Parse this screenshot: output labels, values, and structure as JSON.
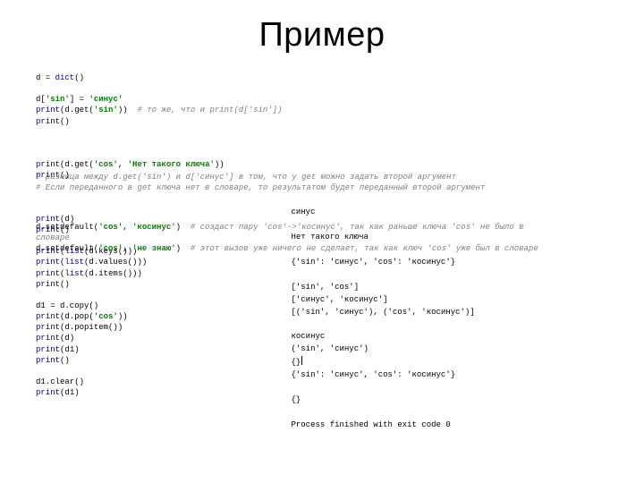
{
  "title": "Пример",
  "code_block1": [
    {
      "segs": [
        {
          "t": "d = "
        },
        {
          "t": "dict",
          "c": "fn"
        },
        {
          "t": "()"
        }
      ]
    },
    {
      "segs": []
    },
    {
      "segs": [
        {
          "t": "d["
        },
        {
          "t": "'sin'",
          "c": "str"
        },
        {
          "t": "] = "
        },
        {
          "t": "'синус'",
          "c": "str"
        }
      ]
    },
    {
      "segs": [
        {
          "t": "print",
          "c": "fn"
        },
        {
          "t": "(d.get("
        },
        {
          "t": "'sin'",
          "c": "str"
        },
        {
          "t": "))  "
        },
        {
          "t": "# то же, что и print(d['sin'])",
          "c": "cm"
        }
      ]
    },
    {
      "segs": [
        {
          "t": "print",
          "c": "fn"
        },
        {
          "t": "()"
        }
      ]
    }
  ],
  "wide_comment": [
    "# разница между d.get('sin') и d['синус'] в том, что у get можно задать второй аргумент",
    "# Если переданного в get ключа нет в словаре, то результатом будет переданный второй аргумент"
  ],
  "code_block2": [
    {
      "segs": [
        {
          "t": "print",
          "c": "fn"
        },
        {
          "t": "(d.get("
        },
        {
          "t": "'cos'",
          "c": "str"
        },
        {
          "t": ", "
        },
        {
          "t": "'Нет такого ключа'",
          "c": "str"
        },
        {
          "t": "))"
        }
      ]
    },
    {
      "segs": [
        {
          "t": "print",
          "c": "fn"
        },
        {
          "t": "()"
        }
      ]
    }
  ],
  "setdefault_lines": [
    {
      "segs": [
        {
          "t": "d.setdefault("
        },
        {
          "t": "'cos'",
          "c": "str"
        },
        {
          "t": ", "
        },
        {
          "t": "'косинус'",
          "c": "str"
        },
        {
          "t": ")  "
        },
        {
          "t": "# создаст пару 'cos'->'косинус', так как раньше ключа 'cos' не было в словаре",
          "c": "cm"
        }
      ]
    },
    {
      "segs": [
        {
          "t": "d.setdefault("
        },
        {
          "t": "'cos'",
          "c": "str"
        },
        {
          "t": ", "
        },
        {
          "t": "'не знаю'",
          "c": "str"
        },
        {
          "t": ")  "
        },
        {
          "t": "# этот вызов уже ничего не сделает, так как ключ 'cos' уже был в словаре",
          "c": "cm"
        }
      ]
    }
  ],
  "code_block3": [
    {
      "segs": [
        {
          "t": "print",
          "c": "fn"
        },
        {
          "t": "(d)"
        }
      ]
    },
    {
      "segs": [
        {
          "t": "print",
          "c": "fn"
        },
        {
          "t": "()"
        }
      ]
    },
    {
      "segs": []
    },
    {
      "segs": [
        {
          "t": "print",
          "c": "fn"
        },
        {
          "t": "("
        },
        {
          "t": "list",
          "c": "fn"
        },
        {
          "t": "(d.keys()))"
        }
      ]
    },
    {
      "segs": [
        {
          "t": "print",
          "c": "fn"
        },
        {
          "t": "("
        },
        {
          "t": "list",
          "c": "fn"
        },
        {
          "t": "(d.values()))"
        }
      ]
    },
    {
      "segs": [
        {
          "t": "print",
          "c": "fn"
        },
        {
          "t": "("
        },
        {
          "t": "list",
          "c": "fn"
        },
        {
          "t": "(d.items()))"
        }
      ]
    },
    {
      "segs": [
        {
          "t": "print",
          "c": "fn"
        },
        {
          "t": "()"
        }
      ]
    },
    {
      "segs": []
    },
    {
      "segs": [
        {
          "t": "d1 = d.copy()"
        }
      ]
    },
    {
      "segs": [
        {
          "t": "print",
          "c": "fn"
        },
        {
          "t": "(d.pop("
        },
        {
          "t": "'cos'",
          "c": "str"
        },
        {
          "t": "))"
        }
      ]
    },
    {
      "segs": [
        {
          "t": "print",
          "c": "fn"
        },
        {
          "t": "(d.popitem())"
        }
      ]
    },
    {
      "segs": [
        {
          "t": "print",
          "c": "fn"
        },
        {
          "t": "(d)"
        }
      ]
    },
    {
      "segs": [
        {
          "t": "print",
          "c": "fn"
        },
        {
          "t": "(d1)"
        }
      ]
    },
    {
      "segs": [
        {
          "t": "print",
          "c": "fn"
        },
        {
          "t": "()"
        }
      ]
    },
    {
      "segs": []
    },
    {
      "segs": [
        {
          "t": "d1.clear()"
        }
      ]
    },
    {
      "segs": [
        {
          "t": "print",
          "c": "fn"
        },
        {
          "t": "(d1)"
        }
      ]
    }
  ],
  "output": [
    "синус",
    "",
    "Нет такого ключа",
    "",
    "{'sin': 'синус', 'cos': 'косинус'}",
    "",
    "['sin', 'cos']",
    "['синус', 'косинус']",
    "[('sin', 'синус'), ('cos', 'косинус')]",
    "",
    "косинус",
    "('sin', 'синус')",
    {
      "text": "{}",
      "caret": true
    },
    "{'sin': 'синус', 'cos': 'косинус'}",
    "",
    "{}",
    "",
    "Process finished with exit code 0"
  ]
}
